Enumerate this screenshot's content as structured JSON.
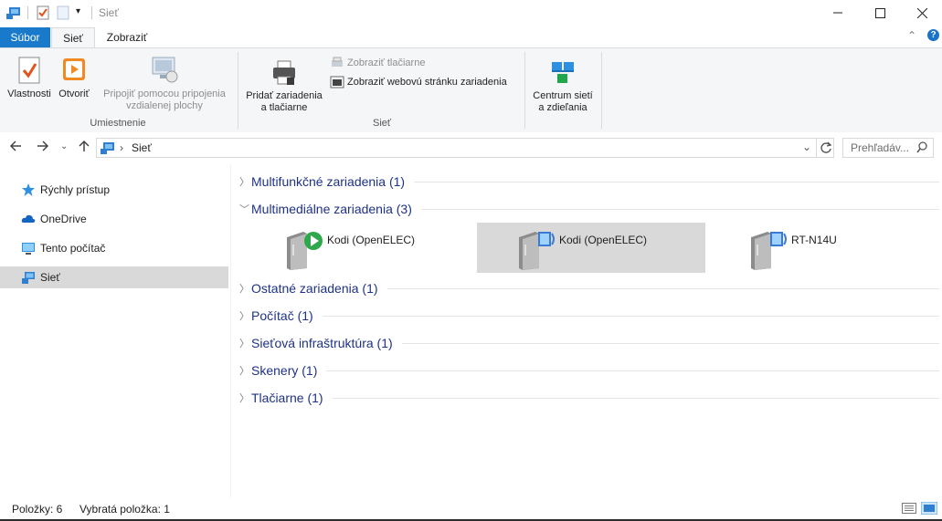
{
  "window": {
    "title": "Sieť"
  },
  "tabs": {
    "file": "Súbor",
    "network": "Sieť",
    "view": "Zobraziť"
  },
  "ribbon": {
    "properties": "Vlastnosti",
    "open": "Otvoriť",
    "remote_l1": "Pripojiť pomocou pripojenia",
    "remote_l2": "vzdialenej plochy",
    "group_location": "Umiestnenie",
    "add_devices_l1": "Pridať zariadenia",
    "add_devices_l2": "a tlačiarne",
    "show_printers": "Zobraziť tlačiarne",
    "show_webpage": "Zobraziť webovú stránku zariadenia",
    "group_network": "Sieť",
    "center_l1": "Centrum sietí",
    "center_l2": "a zdieľania"
  },
  "nav": {
    "path": "Sieť",
    "search_placeholder": "Prehľadáv..."
  },
  "sidebar": {
    "items": [
      {
        "label": "Rýchly prístup"
      },
      {
        "label": "OneDrive"
      },
      {
        "label": "Tento počítač"
      },
      {
        "label": "Sieť"
      }
    ]
  },
  "groups": [
    {
      "label": "Multifunkčné zariadenia (1)"
    },
    {
      "label": "Multimediálne zariadenia (3)"
    },
    {
      "label": "Ostatné zariadenia (1)"
    },
    {
      "label": "Počítač (1)"
    },
    {
      "label": "Sieťová infraštruktúra (1)"
    },
    {
      "label": "Skenery (1)"
    },
    {
      "label": "Tlačiarne (1)"
    }
  ],
  "devices": [
    {
      "label": "Kodi (OpenELEC)"
    },
    {
      "label": "Kodi (OpenELEC)"
    },
    {
      "label": "RT-N14U"
    }
  ],
  "status": {
    "items": "Položky: 6",
    "selected": "Vybratá položka: 1"
  },
  "colors": {
    "accent": "#1979ca",
    "group_text": "#1e3287",
    "selection": "#d9d9d9"
  }
}
